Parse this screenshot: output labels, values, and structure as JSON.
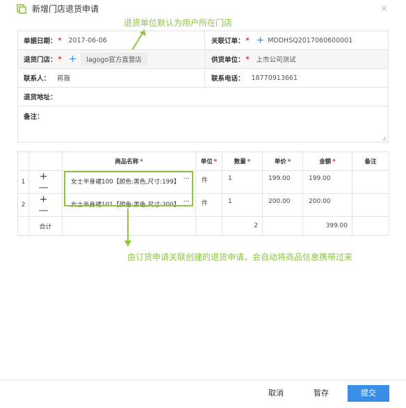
{
  "dialog": {
    "title": "新增门店退货申请",
    "close_label": "×"
  },
  "annotations": {
    "top": "退货单位默认为用户所在门店",
    "bottom": "由订货申请关联创建的退货申请，会自动将商品信息携带过来"
  },
  "form": {
    "date_label": "单据日期：",
    "date_value": "2017-06-06",
    "order_label": "关联订单：",
    "order_value": "MDDHSQ2017060600001",
    "store_label": "退货门店：",
    "store_value": "lagogo官方直营店",
    "supplier_label": "供货单位：",
    "supplier_value": "上市公司测试",
    "contact_label": "联系人：",
    "contact_value": "蒋薇",
    "phone_label": "联系电话：",
    "phone_value": "18770913661",
    "address_label": "退货地址：",
    "remark_label": "备注：",
    "required_mark": "*"
  },
  "table": {
    "headers": {
      "product": "商品名称",
      "unit": "单位",
      "qty": "数量",
      "price": "单价",
      "amount": "金额",
      "remark": "备注"
    },
    "rows": [
      {
        "no": "1",
        "ops": "+ —",
        "product": "女士半身裙100【颜色:黑色,尺寸:199】",
        "more": "···",
        "unit": "件",
        "qty": "1",
        "price": "199.00",
        "amount": "199.00"
      },
      {
        "no": "2",
        "ops": "+ —",
        "product": "女士半身裙101【颜色:黑色,尺寸:200】",
        "more": "···",
        "unit": "件",
        "qty": "1",
        "price": "200.00",
        "amount": "200.00"
      }
    ],
    "total": {
      "label": "合计",
      "qty": "2",
      "amount": "399.00"
    }
  },
  "footer": {
    "cancel": "取消",
    "save_draft": "暂存",
    "submit": "提交"
  },
  "colors": {
    "accent": "#3a8ee6",
    "annotation": "#8cc63f",
    "required": "#e02020"
  }
}
